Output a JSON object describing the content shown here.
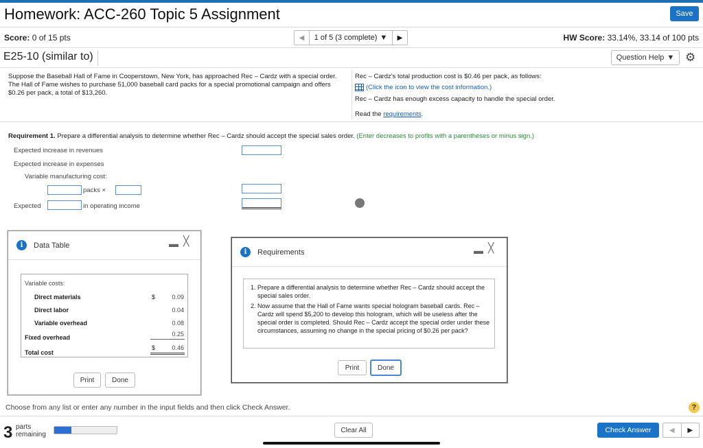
{
  "header": {
    "title": "Homework: ACC-260 Topic 5 Assignment",
    "save_label": "Save",
    "score_label": "Score:",
    "score_value": "0 of 15 pts",
    "pager_label": "1 of 5 (3 complete)",
    "hw_score_label": "HW Score:",
    "hw_score_value": "33.14%, 33.14 of 100 pts"
  },
  "question": {
    "id": "E25-10 (similar to)",
    "help_label": "Question Help"
  },
  "problem": {
    "text": "Suppose the Baseball Hall of Fame in Cooperstown, New York, has approached Rec – Cardz with a special order. The Hall of Fame wishes to purchase 51,000 baseball card packs for a special promotional campaign and offers $0.26 per pack, a total of $13,260.",
    "cost_text": "Rec – Cardz's total production cost is $0.46 per pack, as follows:",
    "icon_text": "(Click the icon to view the cost information.)",
    "capacity_text": "Rec – Cardz has enough excess capacity to handle the special order.",
    "read_text": "Read the",
    "req_link": "requirements",
    "period": "."
  },
  "requirement1": {
    "label": "Requirement 1.",
    "text": "Prepare a differential analysis to determine whether Rec – Cardz should accept the special sales order.",
    "hint": "(Enter decreases to profits with a parentheses or minus sign.)",
    "rows": {
      "revenues": "Expected increase in revenues",
      "expenses": "Expected increase in expenses",
      "variable": "Variable manufacturing cost:",
      "packs_x": "packs ×",
      "expected": "Expected",
      "in_op_income": "in operating income"
    }
  },
  "data_table": {
    "title": "Data Table",
    "section": "Variable costs:",
    "rows": [
      {
        "label": "Direct materials",
        "dollar": "$",
        "value": "0.09"
      },
      {
        "label": "Direct labor",
        "dollar": "",
        "value": "0.04"
      },
      {
        "label": "Variable overhead",
        "dollar": "",
        "value": "0.08"
      },
      {
        "label": "Fixed overhead",
        "dollar": "",
        "value": "0.25"
      },
      {
        "label": "Total cost",
        "dollar": "$",
        "value": "0.46"
      }
    ],
    "print_label": "Print",
    "done_label": "Done"
  },
  "requirements_panel": {
    "title": "Requirements",
    "items": [
      "Prepare a differential analysis to determine whether Rec – Cardz should accept the special sales order.",
      "Now assume that the Hall of Fame wants special hologram baseball cards. Rec – Cardz will spend $5,200 to develop this hologram, which will be useless after the special order is completed. Should Rec – Cardz accept the special order under these circumstances, assuming no change in the special pricing of $0.26 per pack?"
    ],
    "print_label": "Print",
    "done_label": "Done"
  },
  "footer": {
    "instruction": "Choose from any list or enter any number in the input fields and then click Check Answer.",
    "parts_number": "3",
    "parts_line1": "parts",
    "parts_line2": "remaining",
    "progress_fraction": 0.27,
    "clear_label": "Clear All",
    "check_label": "Check Answer"
  }
}
